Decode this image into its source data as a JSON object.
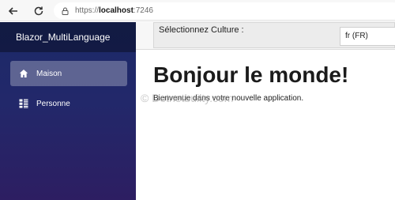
{
  "browser": {
    "url_scheme": "https://",
    "url_host": "localhost",
    "url_port": ":7246"
  },
  "sidebar": {
    "brand": "Blazor_MultiLanguage",
    "items": [
      {
        "label": "Maison",
        "icon": "home-icon",
        "active": true
      },
      {
        "label": "Personne",
        "icon": "list-icon",
        "active": false
      }
    ]
  },
  "topbar": {
    "culture_label": "Sélectionnez Culture :",
    "culture_value": "fr (FR)"
  },
  "main": {
    "title": "Bonjour le monde!",
    "text": "Bienvenue dans votre nouvelle application."
  },
  "watermark": "© Dotnetbuilty.com"
}
